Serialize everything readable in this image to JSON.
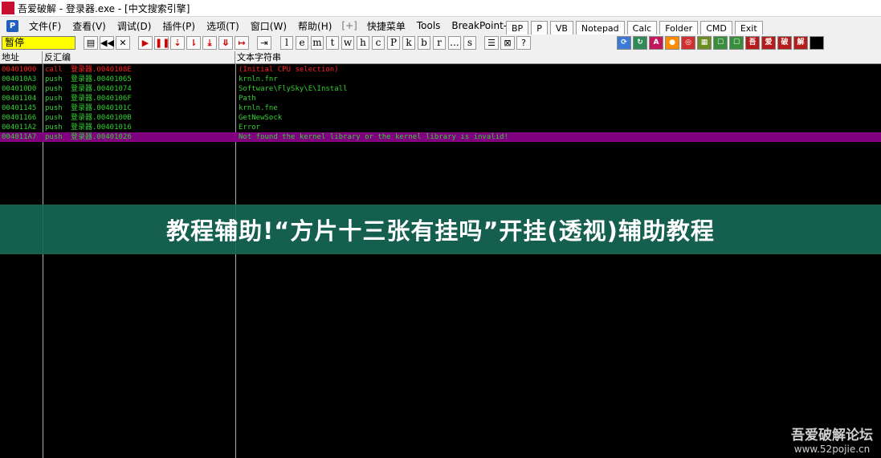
{
  "window": {
    "icon_text": "吾爱破解",
    "title": "吾爱破解 - 登录器.exe - [中文搜索引擎]"
  },
  "menu": {
    "items": [
      "文件(F)",
      "查看(V)",
      "调试(D)",
      "插件(P)",
      "选项(T)",
      "窗口(W)",
      "帮助(H)"
    ],
    "separator": "[+]",
    "extra": [
      "快捷菜单",
      "Tools",
      "BreakPoint->"
    ],
    "plugin_buttons": [
      "BP",
      "P",
      "VB",
      "Notepad",
      "Calc",
      "Folder",
      "CMD",
      "Exit"
    ]
  },
  "toolbar": {
    "status": "暂停",
    "nav_buttons": [
      "open-icon",
      "rewind-icon",
      "close-icon"
    ],
    "debug_buttons": [
      "run-icon",
      "pause-icon",
      "step-into-icon",
      "step-over-icon",
      "trace-into-icon",
      "trace-over-icon",
      "execute-till-return-icon",
      "goto-icon"
    ],
    "letter_buttons": [
      "l",
      "e",
      "m",
      "t",
      "w",
      "h",
      "c",
      "P",
      "k",
      "b",
      "r",
      "...",
      "s"
    ],
    "right_icons": [
      {
        "name": "refresh-icon",
        "color": "#3a7bd5",
        "glyph": "⟳"
      },
      {
        "name": "patch-icon",
        "color": "#2e8b57",
        "glyph": "↻"
      },
      {
        "name": "font-icon",
        "color": "#c2185b",
        "glyph": "A"
      },
      {
        "name": "record-icon",
        "color": "#ff8c00",
        "glyph": "●"
      },
      {
        "name": "target-icon",
        "color": "#d32f2f",
        "glyph": "◎"
      },
      {
        "name": "grid-icon",
        "color": "#6b8e23",
        "glyph": "▦"
      },
      {
        "name": "chat-icon",
        "color": "#388e3c",
        "glyph": "☐"
      },
      {
        "name": "chat2-icon",
        "color": "#388e3c",
        "glyph": "☐"
      }
    ],
    "brand_icons": [
      "吾",
      "爱",
      "破",
      "解"
    ],
    "brand_color": "#b71c1c"
  },
  "table": {
    "headers": [
      "地址",
      "反汇编",
      "文本字符串"
    ],
    "rows": [
      {
        "addr": "00401000",
        "op": "call",
        "arg": "登录器.0040108E",
        "text": "(Initial CPU selection)",
        "color": "#ff2020",
        "selected": false
      },
      {
        "addr": "004010A3",
        "op": "push",
        "arg": "登录器.00401065",
        "text": "krnln.fnr",
        "color": "#30d030",
        "selected": false
      },
      {
        "addr": "004010D0",
        "op": "push",
        "arg": "登录器.00401074",
        "text": "Software\\FlySky\\E\\Install",
        "color": "#30d030",
        "selected": false
      },
      {
        "addr": "00401104",
        "op": "push",
        "arg": "登录器.0040106F",
        "text": "Path",
        "color": "#30d030",
        "selected": false
      },
      {
        "addr": "00401145",
        "op": "push",
        "arg": "登录器.0040101C",
        "text": "krnln.fne",
        "color": "#30d030",
        "selected": false
      },
      {
        "addr": "00401166",
        "op": "push",
        "arg": "登录器.0040100B",
        "text": "GetNewSock",
        "color": "#30d030",
        "selected": false
      },
      {
        "addr": "004011A2",
        "op": "push",
        "arg": "登录器.00401016",
        "text": "Error",
        "color": "#30d030",
        "selected": false
      },
      {
        "addr": "004011A7",
        "op": "push",
        "arg": "登录器.00401026",
        "text": "Not found the kernel library or the kernel library is invalid!",
        "color": "#30d030",
        "selected": true
      }
    ]
  },
  "banner": {
    "text": "教程辅助!“方片十三张有挂吗”开挂(透视)辅助教程"
  },
  "watermark": {
    "name": "吾爱破解论坛",
    "url": "www.52pojie.cn"
  }
}
